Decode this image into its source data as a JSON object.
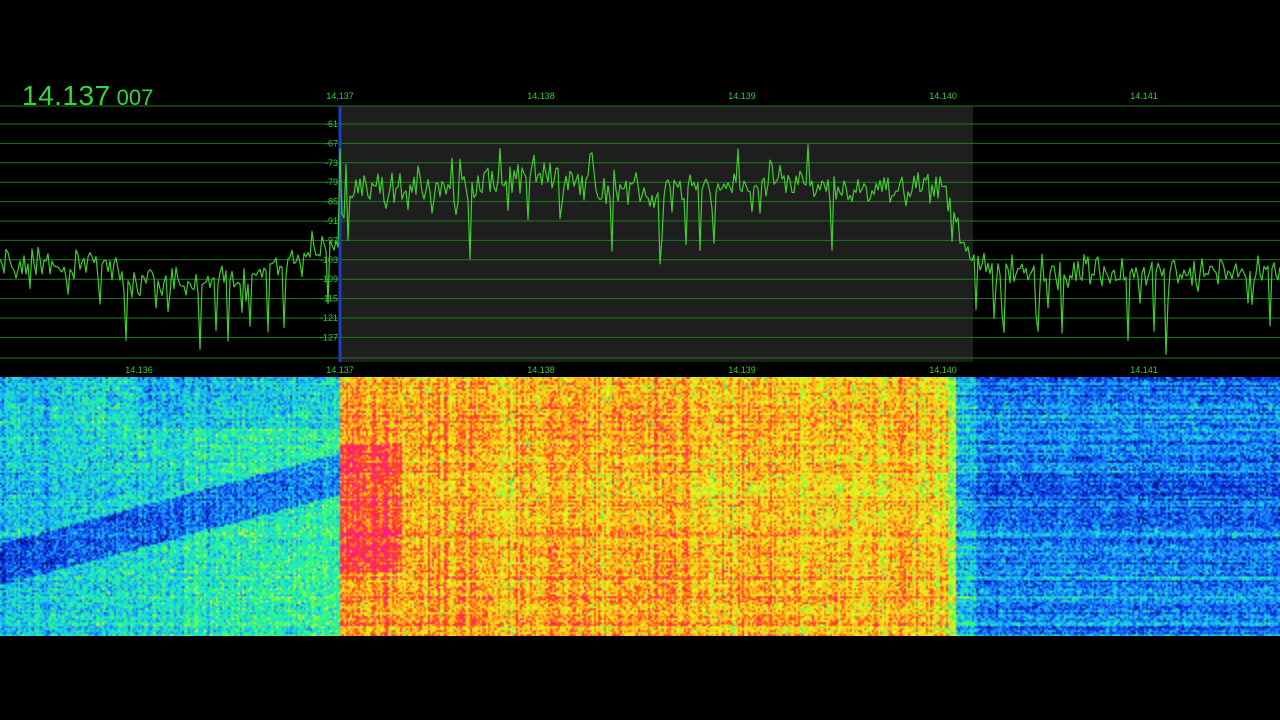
{
  "readout": {
    "freq_main": "14.137",
    "freq_sub": "007"
  },
  "colors": {
    "trace": "#3fce2c",
    "gridline": "#1f7a1f",
    "label": "#38c838",
    "passband_fill": "#1e1e1e",
    "tune_marker": "#1f3fb8",
    "background": "#000000"
  },
  "spectrum": {
    "top_ticks": [
      "14.137",
      "14.138",
      "14.139",
      "14.140",
      "14.141"
    ],
    "bottom_ticks": [
      "14.136",
      "14.137",
      "14.138",
      "14.139",
      "14.140",
      "14.141"
    ],
    "level_labels": [
      "-61",
      "-67",
      "-73",
      "-79",
      "-85",
      "-91",
      "-97",
      "-103",
      "-109",
      "-115",
      "-121",
      "-127"
    ],
    "passband_khz": [
      14.137,
      14.14015
    ]
  },
  "chart_data": {
    "type": "line",
    "series": [
      {
        "x_range_mhz": [
          14.13535,
          14.14169
        ],
        "noise_floor_db": -106,
        "signal_level_db": -80,
        "signal_band_mhz": [
          14.137,
          14.14
        ]
      }
    ],
    "ylim": [
      -130,
      -58
    ],
    "grid": true
  },
  "waterfall": {
    "palette": [
      "#000a6e",
      "#0b2ee0",
      "#1a8cff",
      "#19e0e0",
      "#33ff66",
      "#e6ff1a",
      "#ffc21a",
      "#ff3d1a",
      "#ff1a90"
    ]
  }
}
